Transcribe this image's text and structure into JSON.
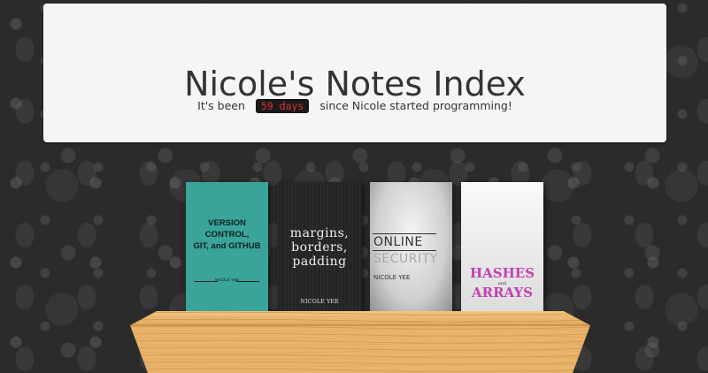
{
  "header": {
    "title": "Nicole's Notes Index",
    "subtitle_prefix": "It's been",
    "days_counter": "59 days",
    "subtitle_suffix": "since Nicole started programming!"
  },
  "books": [
    {
      "title_lines": [
        "VERSION CONTROL,",
        "GIT, and GITHUB"
      ],
      "author": "NICOLE YEE",
      "color": "#3aa39a"
    },
    {
      "title_lines": [
        "margins,",
        "borders,",
        "padding"
      ],
      "author": "NICOLE YEE",
      "color": "#262626"
    },
    {
      "title_lines": [
        "ONLINE",
        "SECURITY"
      ],
      "author": "NICOLE  YEE",
      "color": "#e0e0e0"
    },
    {
      "title_lines": [
        "HASHES",
        "and",
        "ARRAYS"
      ],
      "color": "#f0f0f0"
    }
  ],
  "colors": {
    "background": "#2b2b2b",
    "panel": "#f5f5f5",
    "counter_text": "#e03232",
    "hashes_title": "#c43fb5",
    "shelf_wood": "#e8b36a"
  }
}
